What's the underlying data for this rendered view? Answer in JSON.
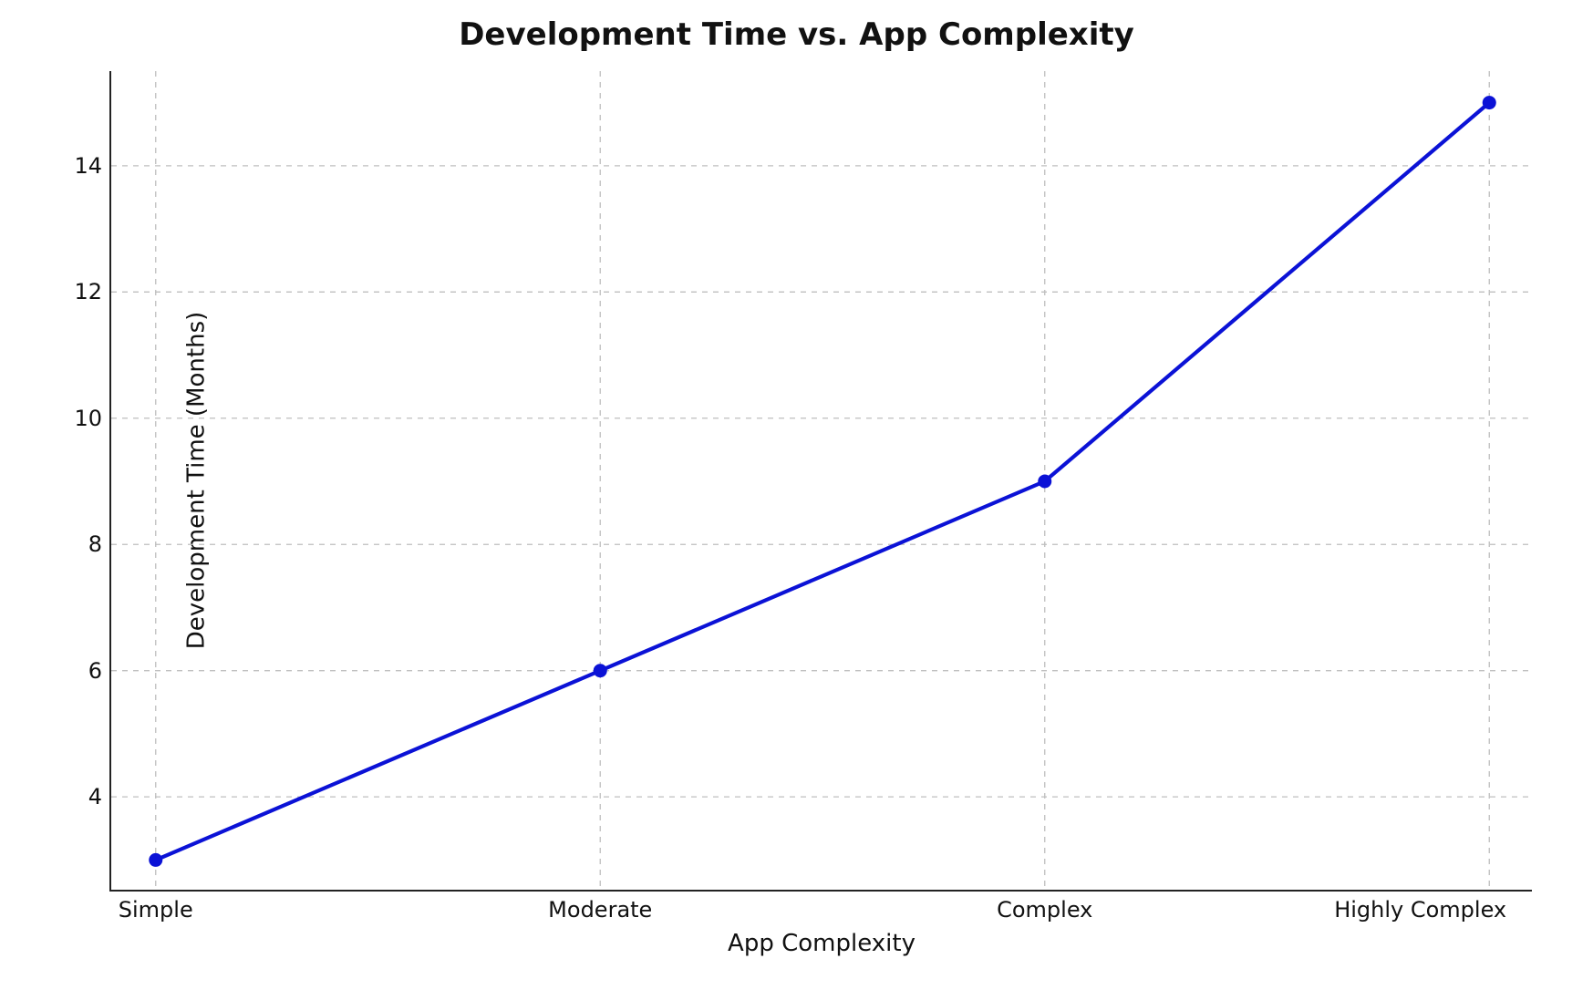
{
  "chart_data": {
    "type": "line",
    "title": "Development Time vs. App Complexity",
    "xlabel": "App Complexity",
    "ylabel": "Development Time (Months)",
    "categories": [
      "Simple",
      "Moderate",
      "Complex",
      "Highly Complex"
    ],
    "values": [
      3,
      6,
      9,
      15
    ],
    "y_ticks": [
      4,
      6,
      8,
      10,
      12,
      14
    ],
    "ylim": [
      2.5,
      15.5
    ],
    "xlim_index": [
      -0.1,
      3.1
    ],
    "grid": true,
    "line_color": "#0b12d6",
    "marker": "circle"
  }
}
